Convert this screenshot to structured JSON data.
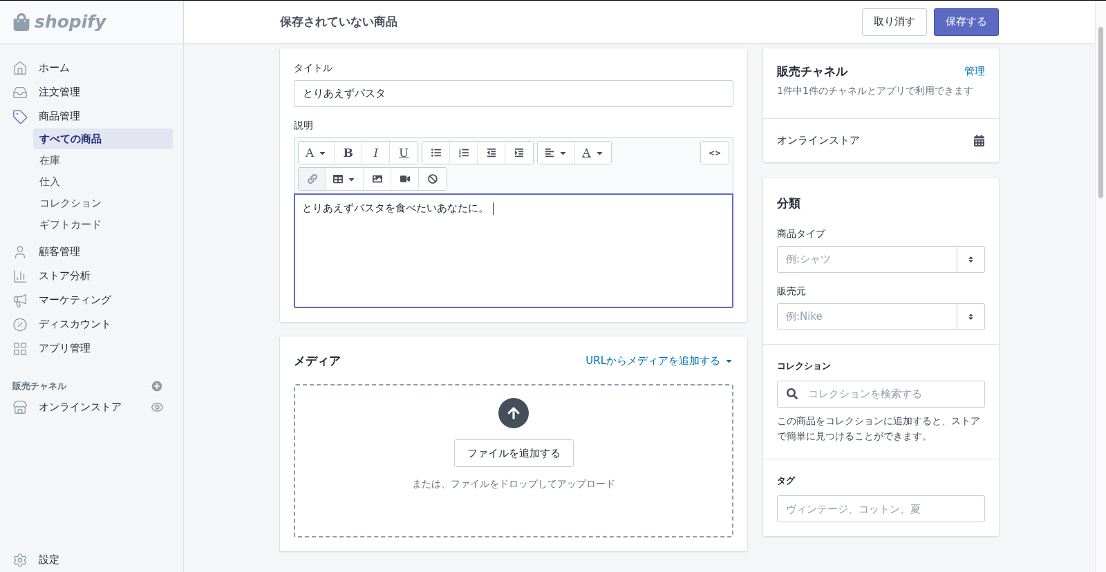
{
  "brand": {
    "name": "shopify"
  },
  "topbar": {
    "title": "保存されていない商品",
    "buttons": [
      {
        "label": "取り消す",
        "kind": "secondary"
      },
      {
        "label": "保存する",
        "kind": "primary"
      }
    ]
  },
  "sidebar": {
    "items": [
      {
        "label": "ホーム",
        "kind": "home",
        "active": false
      },
      {
        "label": "注文管理",
        "kind": "orders",
        "active": false
      },
      {
        "label": "商品管理",
        "kind": "products",
        "active": true,
        "children": [
          {
            "label": "すべての商品",
            "selected": true
          },
          {
            "label": "在庫",
            "selected": false
          },
          {
            "label": "仕入",
            "selected": false
          },
          {
            "label": "コレクション",
            "selected": false
          },
          {
            "label": "ギフトカード",
            "selected": false
          }
        ]
      },
      {
        "label": "顧客管理",
        "kind": "customers",
        "active": false
      },
      {
        "label": "ストア分析",
        "kind": "analytics",
        "active": false
      },
      {
        "label": "マーケティング",
        "kind": "marketing",
        "active": false
      },
      {
        "label": "ディスカウント",
        "kind": "discounts",
        "active": false
      },
      {
        "label": "アプリ管理",
        "kind": "apps",
        "active": false
      }
    ],
    "channels_heading": "販売チャネル",
    "channels": [
      {
        "label": "オンラインストア"
      }
    ],
    "settings": {
      "label": "設定"
    }
  },
  "product": {
    "title_label": "タイトル",
    "title_value": "とりあえずパスタ",
    "description_label": "説明",
    "toolbar": [
      [
        [
          {
            "kind": "font",
            "label": "A",
            "disabled": false
          },
          {
            "kind": "bold",
            "label": "B",
            "disabled": false
          },
          {
            "kind": "italic",
            "label": "I",
            "disabled": false
          },
          {
            "kind": "underline",
            "label": "U",
            "disabled": false
          }
        ],
        [
          {
            "kind": "bullets",
            "disabled": false
          },
          {
            "kind": "numbers",
            "disabled": false
          },
          {
            "kind": "outdent",
            "disabled": false
          },
          {
            "kind": "indent",
            "disabled": false
          }
        ],
        [
          {
            "kind": "align",
            "disabled": false
          },
          {
            "kind": "color",
            "label": "A",
            "disabled": false
          }
        ],
        [
          {
            "kind": "code",
            "label": "<>",
            "disabled": false
          }
        ]
      ],
      [
        [
          {
            "kind": "link",
            "disabled": true
          },
          {
            "kind": "table",
            "disabled": false
          },
          {
            "kind": "image",
            "disabled": false
          },
          {
            "kind": "video",
            "disabled": false
          },
          {
            "kind": "clear",
            "disabled": false
          }
        ]
      ]
    ],
    "description": "とりあえずパスタを食べたいあなたに。"
  },
  "media": {
    "heading": "メディア",
    "add_url_link": "URLからメディアを追加する",
    "upload_button": "ファイルを追加する",
    "hint": "または、ファイルをドロップしてアップロード"
  },
  "sales_channels": {
    "heading": "販売チャネル",
    "manage_link": "管理",
    "subtitle": "1件中1件のチャネルとアプリで利用できます",
    "channels": [
      {
        "label": "オンラインストア"
      }
    ]
  },
  "organization": {
    "heading": "分類",
    "fields": [
      {
        "label": "商品タイプ",
        "placeholder": "例:シャツ"
      },
      {
        "label": "販売元",
        "placeholder": "例:Nike"
      }
    ],
    "collections": {
      "label": "コレクション",
      "placeholder": "コレクションを検索する",
      "help": "この商品をコレクションに追加すると、ストアで簡単に見つけることができます。"
    },
    "tags": {
      "label": "タグ",
      "placeholder": "ヴィンテージ、コットン、夏"
    }
  }
}
